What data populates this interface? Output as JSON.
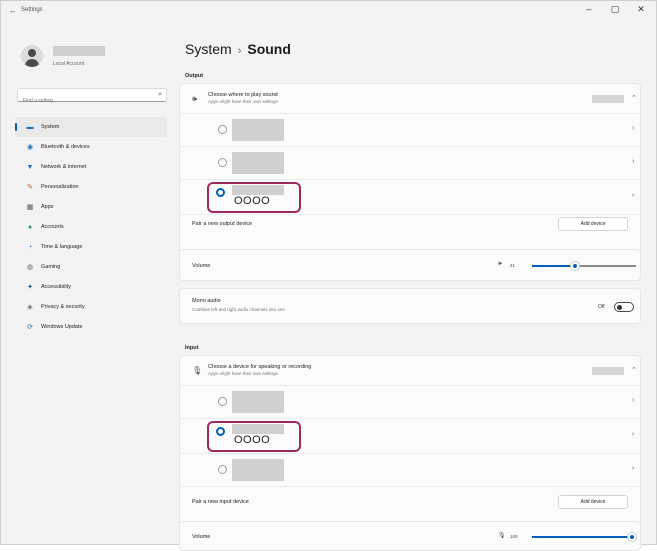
{
  "window": {
    "back_glyph": "←",
    "title": "Settings",
    "controls": [
      "–",
      "▢",
      "✕"
    ]
  },
  "profile": {
    "account_label": "Local Account"
  },
  "search": {
    "placeholder": "Find a setting",
    "icon": "search-icon"
  },
  "nav": {
    "items": [
      {
        "label": "System",
        "icon": "▬",
        "active": true
      },
      {
        "label": "Bluetooth & devices",
        "icon": "◉"
      },
      {
        "label": "Network & internet",
        "icon": "▼"
      },
      {
        "label": "Personalization",
        "icon": "✎"
      },
      {
        "label": "Apps",
        "icon": "▦"
      },
      {
        "label": "Accounts",
        "icon": "●"
      },
      {
        "label": "Time & language",
        "icon": "◔"
      },
      {
        "label": "Gaming",
        "icon": "◍"
      },
      {
        "label": "Accessibility",
        "icon": "✦"
      },
      {
        "label": "Privacy & security",
        "icon": "◈"
      },
      {
        "label": "Windows Update",
        "icon": "⟳"
      }
    ]
  },
  "breadcrumb": {
    "parent": "System",
    "separator": "›",
    "current": "Sound"
  },
  "output": {
    "section_label": "Output",
    "header_title": "Choose where to play sound",
    "header_sub": "Apps might have their own settings",
    "selected_device_name": "OOOO",
    "pair_text": "Pair a new output device",
    "add_button": "Add device"
  },
  "volume": {
    "label": "Volume",
    "value": "41",
    "level": 0.41
  },
  "mono": {
    "label": "Mono audio",
    "sub": "Combine left and right audio channels into one",
    "state": "Off"
  },
  "input": {
    "section_label": "Input",
    "header_title": "Choose a device for speaking or recording",
    "header_sub": "Apps might have their own settings",
    "selected_device_name": "OOOO",
    "pair_text": "Pair a new input device",
    "add_button": "Add device"
  },
  "input_volume": {
    "label": "Volume",
    "value": "100",
    "level": 1.0
  },
  "colors": {
    "accent": "#005fb8",
    "highlight": "#9c2a5c"
  }
}
